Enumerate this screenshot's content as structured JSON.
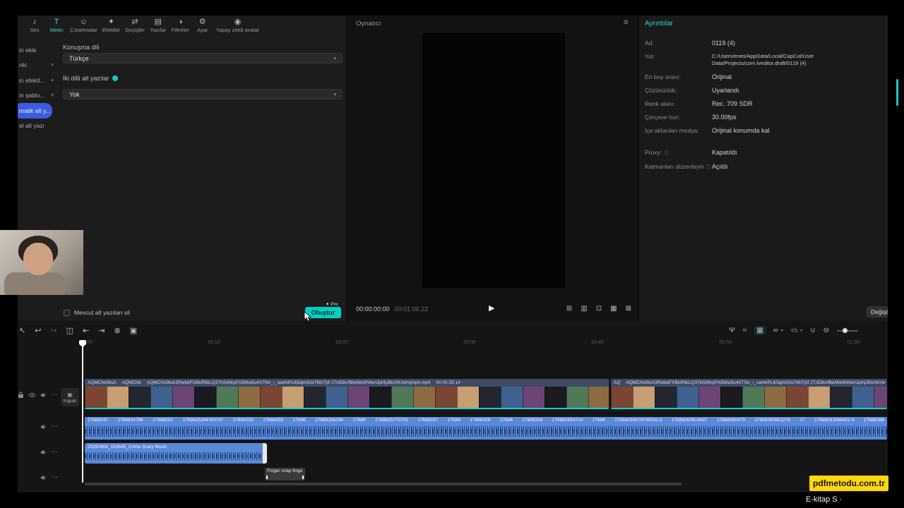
{
  "icons": {
    "chevron": "▾",
    "info": "ⓘ",
    "dots": "⋯",
    "hamburger": "≡",
    "play": "▶",
    "pro_star": "✦",
    "cover_glyph": "▣"
  },
  "topbar": {
    "items": [
      {
        "label": "Ses",
        "glyph": "♪"
      },
      {
        "label": "Metin",
        "glyph": "T"
      },
      {
        "label": "Çıkartmalar",
        "glyph": "☺"
      },
      {
        "label": "Efektler",
        "glyph": "✦"
      },
      {
        "label": "Geçişler",
        "glyph": "⇄"
      },
      {
        "label": "Yazılar",
        "glyph": "▤"
      },
      {
        "label": "Filtreler",
        "glyph": "◑"
      },
      {
        "label": "Ayar",
        "glyph": "⚙"
      },
      {
        "label": "Yapay zekâ avatar",
        "glyph": "◉"
      }
    ]
  },
  "sidebar": {
    "items": [
      {
        "label": "in ekle"
      },
      {
        "label": "nki"
      },
      {
        "label": "in efektl..."
      },
      {
        "label": "in şablo..."
      },
      {
        "label": "matik alt y..."
      },
      {
        "label": "el alt yazı"
      }
    ]
  },
  "caption_panel": {
    "language_label": "Konuşma dili",
    "language_value": "Türkçe",
    "bilingual_label": "İki dilli alt yazılar",
    "bilingual_value": "Yok",
    "delete_existing_label": "Mevcut alt yazıları sil",
    "create_button": "Oluştur",
    "pro_badge": "Pro"
  },
  "player": {
    "title": "Oynatıcı",
    "current_time": "00:00:00:00",
    "total_time": "00:01:06:22",
    "icons": [
      {
        "glyph": "⊞"
      },
      {
        "glyph": "▥"
      },
      {
        "glyph": "⊡"
      },
      {
        "glyph": "▦"
      },
      {
        "glyph": "⊠"
      }
    ]
  },
  "details": {
    "title": "Ayrıntılar",
    "rows": [
      {
        "label": "Ad:",
        "value": "0119 (4)"
      },
      {
        "label": "Yol:",
        "value": "C:/Users/enes/AppData/Local/CapCut/User Data/Projects/com.lveditor.draft/0119 (4)"
      },
      {
        "label": "En boy oranı:",
        "value": "Orijinal"
      },
      {
        "label": "Çözünürlük:",
        "value": "Uyarlandı"
      },
      {
        "label": "Renk alanı:",
        "value": "Rec. 709 SDR"
      },
      {
        "label": "Çerçeve hızı:",
        "value": "30.00fps"
      },
      {
        "label": "İçe aktarılan medya:",
        "value": "Orijinal konumda kal"
      },
      {
        "label": "Proxy:",
        "value": "Kapatıldı"
      },
      {
        "label": "Katmanları düzenleyin",
        "value": "Açıldı"
      }
    ],
    "change_button": "Değişt"
  },
  "timeline": {
    "tools_left": [
      {
        "glyph": "↖"
      },
      {
        "glyph": "↩"
      },
      {
        "glyph": "↪"
      },
      {
        "glyph": "◫"
      },
      {
        "glyph": "⇤"
      },
      {
        "glyph": "⇥"
      },
      {
        "glyph": "⊗"
      },
      {
        "glyph": "▣"
      }
    ],
    "tools_right": [
      {
        "glyph": "Ψ"
      },
      {
        "glyph": "≈"
      },
      {
        "glyph": "▦"
      },
      {
        "glyph": "∞"
      },
      {
        "glyph": "▭"
      },
      {
        "glyph": "∪"
      },
      {
        "glyph": "⊖"
      }
    ],
    "ruler_ticks": [
      "00:00",
      "00:10",
      "00:20",
      "00:30",
      "00:40",
      "00:50",
      "01:00"
    ],
    "cover_button": "Kapak",
    "video": {
      "clip1_segments": [
        "AQMCNx9tsA",
        "AQMCNx",
        "AQMCNx9tsA3RwbbFXBkIRlbLQ37ln549rpFA5Ww5u4XTNn_ı_uwrlnPLlk5qlmGtx7MrI7pf JTnD9crfBwWeWWerlJplrtjJ8IxXKrIehrjmp4.mp4"
      ],
      "clip1_duration": "00:00:35:14",
      "clip2_segments": [
        "AQ",
        "AQMCNx9tsA3RwbbFXBkIRlbLQ37ln549rpFA5Ww5u4XTNn_ı_uwrlnPLlk5qlmGtx7MrI7pf JTnD9crfBwWeWWerlJplrtjJ8IxXKrIe"
      ]
    },
    "audio_names": [
      "17688247",
      "1768824786",
      "17688252",
      "1768825284763747",
      "17688253",
      "17688253",
      "17688",
      "17688256206",
      "17688",
      "1768825770702",
      "17688257",
      "17688",
      "17688258",
      "17688",
      "17688259",
      "176882594714",
      "17688",
      "17688259879706042-3",
      "17688260614687",
      "17688260479",
      "17688260951276",
      "17",
      "17688261988422-4",
      "17688266"
    ],
    "music_name": "20250906_153645_Crime Scary Music",
    "text_clip_name": "Finger snap finge"
  },
  "overlay": {
    "watermark": "pdfmetodu.com.tr",
    "caption": "E-kitap S ·"
  }
}
